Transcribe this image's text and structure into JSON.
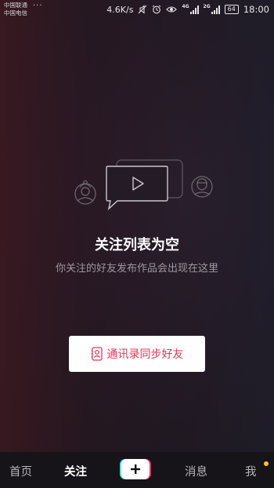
{
  "status_bar": {
    "carrier_1": "中国联通",
    "carrier_2": "中国电信",
    "more": "···",
    "net_speed": "4.6K/s",
    "net_type_1": "4G",
    "net_type_2": "2G",
    "battery": "64",
    "time": "18:00"
  },
  "empty_state": {
    "title": "关注列表为空",
    "subtitle": "你关注的好友发布作品会出现在这里",
    "sync_button_label": "通讯录同步好友"
  },
  "bottom_nav": {
    "items": [
      {
        "label": "首页"
      },
      {
        "label": "关注"
      },
      {
        "label": "消息"
      },
      {
        "label": "我"
      }
    ],
    "active": "关注",
    "add_icon": "plus-icon"
  },
  "colors": {
    "accent": "#f23056",
    "cyan": "#3ff0ee",
    "notification_dot": "#f7c533"
  }
}
